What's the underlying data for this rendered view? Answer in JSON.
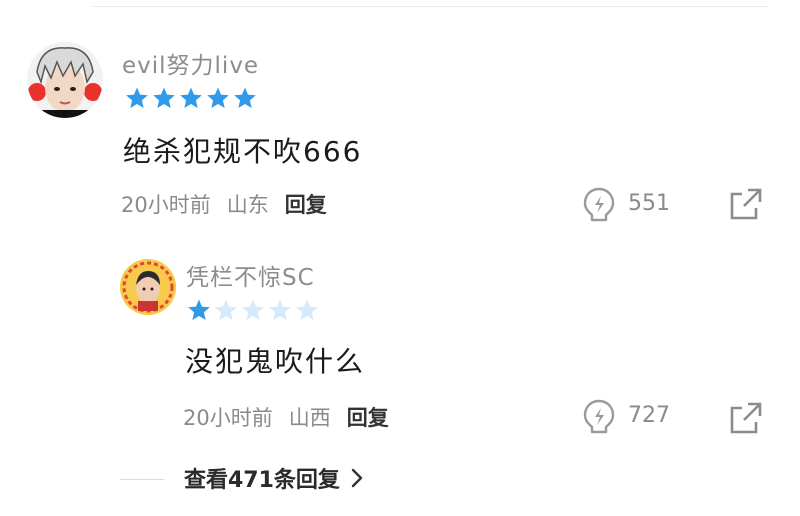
{
  "comment": {
    "username": "evil努力live",
    "rating": 5,
    "text": "绝杀犯规不吹666",
    "time": "20小时前",
    "location": "山东",
    "reply_label": "回复",
    "likes": "551"
  },
  "reply": {
    "username": "凭栏不惊SC",
    "rating": 1,
    "text": "没犯鬼吹什么",
    "time": "20小时前",
    "location": "山西",
    "reply_label": "回复",
    "likes": "727"
  },
  "view_more": {
    "label": "查看471条回复"
  },
  "colors": {
    "star_filled": "#2f9be8",
    "star_empty": "#d4ebfb",
    "text_muted": "#8a8a8a"
  }
}
